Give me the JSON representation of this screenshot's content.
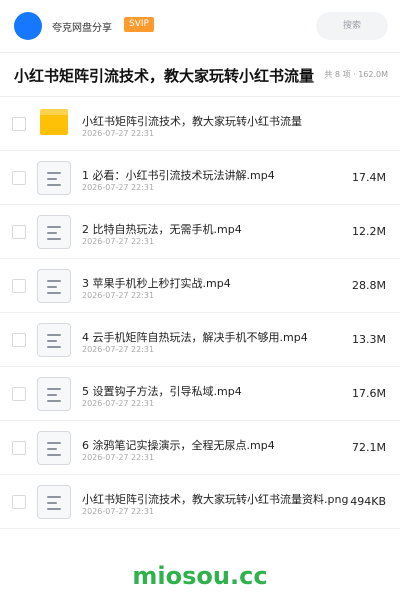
{
  "header": {
    "sharer": "夸克网盘分享",
    "badge": "SVIP",
    "search_placeholder": "搜索"
  },
  "folder": {
    "title": "小红书矩阵引流技术，教大家玩转小红书流量",
    "meta": "共 8 项 · 162.0M"
  },
  "items": [
    {
      "type": "folder",
      "name": "小红书矩阵引流技术，教大家玩转小红书流量",
      "date": "2026-07-27 22:31",
      "size": ""
    },
    {
      "type": "file",
      "name": "1 必看：小红书引流技术玩法讲解.mp4",
      "date": "2026-07-27 22:31",
      "size": "17.4M"
    },
    {
      "type": "file",
      "name": "2 比特自热玩法，无需手机.mp4",
      "date": "2026-07-27 22:31",
      "size": "12.2M"
    },
    {
      "type": "file",
      "name": "3 苹果手机秒上秒打实战.mp4",
      "date": "2026-07-27 22:31",
      "size": "28.8M"
    },
    {
      "type": "file",
      "name": "4 云手机矩阵自热玩法，解决手机不够用.mp4",
      "date": "2026-07-27 22:31",
      "size": "13.3M"
    },
    {
      "type": "file",
      "name": "5 设置钩子方法，引导私域.mp4",
      "date": "2026-07-27 22:31",
      "size": "17.6M"
    },
    {
      "type": "file",
      "name": "6 涂鸦笔记实操演示，全程无尿点.mp4",
      "date": "2026-07-27 22:31",
      "size": "72.1M"
    },
    {
      "type": "file",
      "name": "小红书矩阵引流技术，教大家玩转小红书流量资料.png",
      "date": "2026-07-27 22:31",
      "size": "494KB"
    }
  ],
  "icons": {
    "folder": "folder-icon",
    "file": "document-icon",
    "avatar_color": "#1677ff",
    "badge_color": "#ff9a2e"
  },
  "watermark": "miosou.cc"
}
